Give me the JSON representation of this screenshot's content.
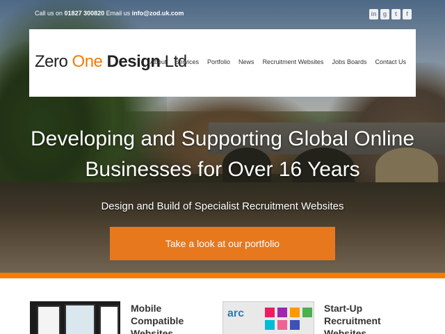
{
  "topbar": {
    "call_label": "Call us on",
    "phone": "01827 300820",
    "email_label": "Email us",
    "email": "info@zod.uk.com"
  },
  "social": [
    {
      "icon": "linkedin-icon",
      "glyph": "in"
    },
    {
      "icon": "google-plus-icon",
      "glyph": "g"
    },
    {
      "icon": "twitter-icon",
      "glyph": "t"
    },
    {
      "icon": "facebook-icon",
      "glyph": "f"
    }
  ],
  "logo": {
    "part1": "Zero",
    "part2": "One",
    "part3": "Design",
    "part4": "Ltd"
  },
  "nav": [
    "About",
    "Services",
    "Portfolio",
    "News",
    "Recruitment Websites",
    "Jobs Boards",
    "Contact Us"
  ],
  "hero": {
    "headline_line1": "Developing and Supporting Global Online",
    "headline_line2": "Businesses for Over 16 Years",
    "subline": "Design and Build of Specialist Recruitment Websites",
    "cta": "Take a look at our portfolio"
  },
  "features": [
    {
      "title_line1": "Mobile Compatible",
      "title_line2": "Websites"
    },
    {
      "title_line1": "Start-Up Recruitment",
      "title_line2": "Websites"
    }
  ],
  "colors": {
    "accent": "#f57c00",
    "cta": "#e8781e"
  }
}
